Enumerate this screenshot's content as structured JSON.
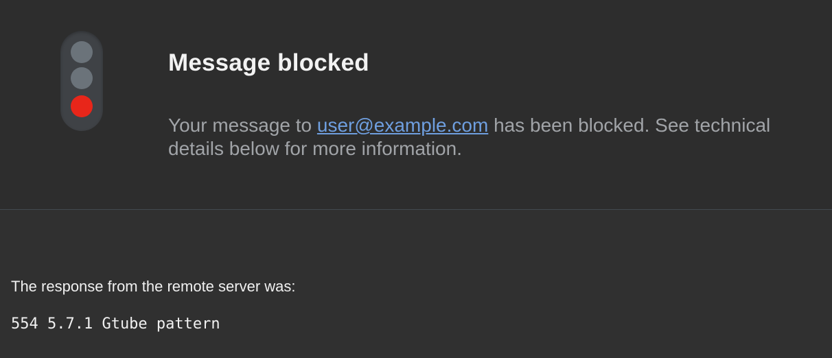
{
  "header": {
    "title": "Message blocked",
    "message_prefix": "Your message to ",
    "recipient": "user@example.com",
    "message_suffix": " has been blocked. See technical details below for more information."
  },
  "icon": {
    "name": "traffic-light-icon",
    "state": "red",
    "colors": {
      "off": "#6b737a",
      "red": "#e8261a"
    }
  },
  "details": {
    "response_label": "The response from the remote server was:",
    "response_code": "554 5.7.1 Gtube pattern"
  },
  "colors": {
    "link": "#6f9fe0",
    "title": "#f2f2f2",
    "body_text": "#a1a4a8"
  }
}
